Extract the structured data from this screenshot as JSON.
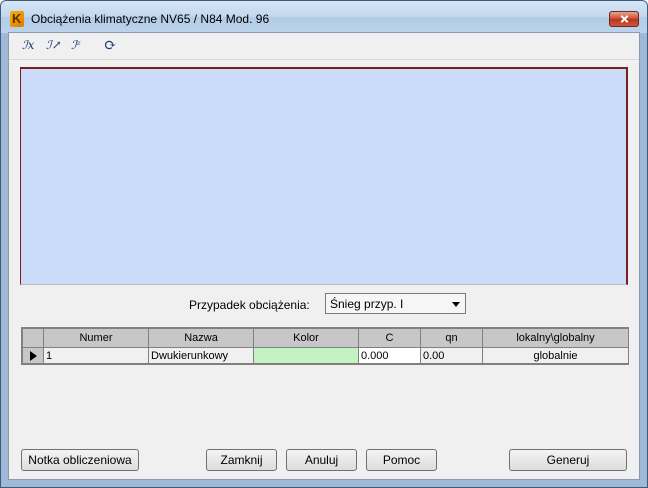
{
  "window": {
    "title": "Obciążenia klimatyczne  NV65 / N84 Mod. 96"
  },
  "toolbar": {
    "buttons": [
      {
        "icon": "zoom-out-icon",
        "glyph": "ℐx"
      },
      {
        "icon": "zoom-in-icon",
        "glyph": "ℐ↗"
      },
      {
        "icon": "zoom-window-icon",
        "glyph": "ℐᶻ"
      },
      {
        "icon": "refresh-icon",
        "glyph": "⟳"
      }
    ]
  },
  "load_case": {
    "label": "Przypadek obciążenia:",
    "selected": "Śnieg przyp. I"
  },
  "table": {
    "headers": [
      "Numer",
      "Nazwa",
      "Kolor",
      "C",
      "qn",
      "lokalny\\globalny"
    ],
    "rows": [
      {
        "numer": "1",
        "nazwa": "Dwukierunkowy",
        "kolor": "",
        "c": "0.000",
        "qn": "0.00",
        "lokalny_globalny": "globalnie",
        "kolor_hex": "#c3f3c3"
      }
    ]
  },
  "buttons": {
    "note": "Notka obliczeniowa",
    "close": "Zamknij",
    "cancel": "Anuluj",
    "help": "Pomoc",
    "generate": "Generuj"
  },
  "colors": {
    "viewport_bg": "#cbdcfa",
    "viewport_border": "#7a1f1f",
    "close_button": "#c94a33"
  }
}
